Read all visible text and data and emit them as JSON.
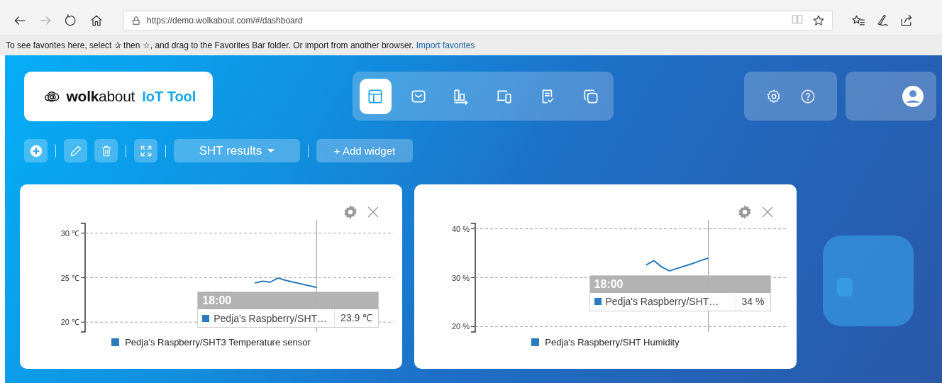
{
  "browser": {
    "url": "https://demo.wolkabout.com/#/dashboard"
  },
  "favorites_bar": {
    "message": "To see favorites here, select ✰ then ☆, and drag to the Favorites Bar folder. Or import from another browser.",
    "link": "Import favorites"
  },
  "logo": {
    "brand": "**wolk**about",
    "product": "IoT Tool"
  },
  "nav": [
    {
      "selected": true
    },
    {
      "selected": false
    },
    {
      "selected": false
    },
    {
      "selected": false
    },
    {
      "selected": false
    },
    {
      "selected": false
    }
  ],
  "toolbar": {
    "dashboard": "SHT results",
    "add_widget": "+ Add widget"
  },
  "widgets": [
    {
      "chart_data": {
        "type": "line",
        "categories": [
          null,
          null,
          null,
          null,
          null,
          null,
          null,
          null,
          null,
          null,
          null,
          null,
          null,
          null,
          null,
          null,
          null,
          null,
          null,
          null,
          null,
          null,
          null,
          null,
          null,
          null,
          null,
          null,
          null,
          null,
          null,
          null,
          null,
          null,
          null,
          null,
          null,
          null,
          null,
          null,
          null
        ],
        "grid": true,
        "ylim": [
          18.9,
          31.1
        ],
        "yticks": [
          {
            "value": 20,
            "label": "20 ℃"
          },
          {
            "value": 25,
            "label": "25 ℃"
          },
          {
            "value": 30,
            "label": "30 ℃"
          }
        ],
        "series": [
          {
            "name": "Pedja's Raspberry/SHT3 Temperature sensor",
            "color": "#2b7bbd",
            "values": [
              null,
              null,
              null,
              null,
              null,
              null,
              null,
              null,
              null,
              null,
              null,
              null,
              null,
              null,
              null,
              null,
              null,
              null,
              null,
              null,
              null,
              null,
              24.4,
              24.6,
              24.5,
              24.95,
              24.7,
              24.5,
              24.3,
              24.1,
              23.9,
              null,
              null,
              null,
              null,
              null,
              null,
              null,
              null,
              null,
              null
            ]
          }
        ]
      },
      "tooltip": {
        "time": "18:00",
        "label": "Pedja's Raspberry/SHT…",
        "value": "23.9 ℃"
      }
    },
    {
      "chart_data": {
        "type": "line",
        "categories": [
          null,
          null,
          null,
          null,
          null,
          null,
          null,
          null,
          null,
          null,
          null,
          null,
          null,
          null,
          null,
          null,
          null,
          null,
          null,
          null,
          null,
          null,
          null,
          null,
          null,
          null,
          null,
          null,
          null,
          null,
          null,
          null,
          null,
          null,
          null,
          null,
          null,
          null,
          null,
          null,
          null
        ],
        "grid": true,
        "ylim": [
          18.9,
          41.1
        ],
        "yticks": [
          {
            "value": 20,
            "label": "20 %"
          },
          {
            "value": 30,
            "label": "30 %"
          },
          {
            "value": 40,
            "label": "40 %"
          }
        ],
        "series": [
          {
            "name": "Pedja's Raspberry/SHT Humidity",
            "color": "#2b7bbd",
            "values": [
              null,
              null,
              null,
              null,
              null,
              null,
              null,
              null,
              null,
              null,
              null,
              null,
              null,
              null,
              null,
              null,
              null,
              null,
              null,
              null,
              null,
              null,
              32.6,
              33.5,
              32.2,
              31.4,
              31.9,
              32.4,
              32.9,
              33.5,
              34,
              null,
              null,
              null,
              null,
              null,
              null,
              null,
              null,
              null,
              null
            ]
          }
        ]
      },
      "tooltip": {
        "time": "18:00",
        "label": "Pedja's Raspberry/SHT…",
        "value": "34 %"
      }
    }
  ]
}
